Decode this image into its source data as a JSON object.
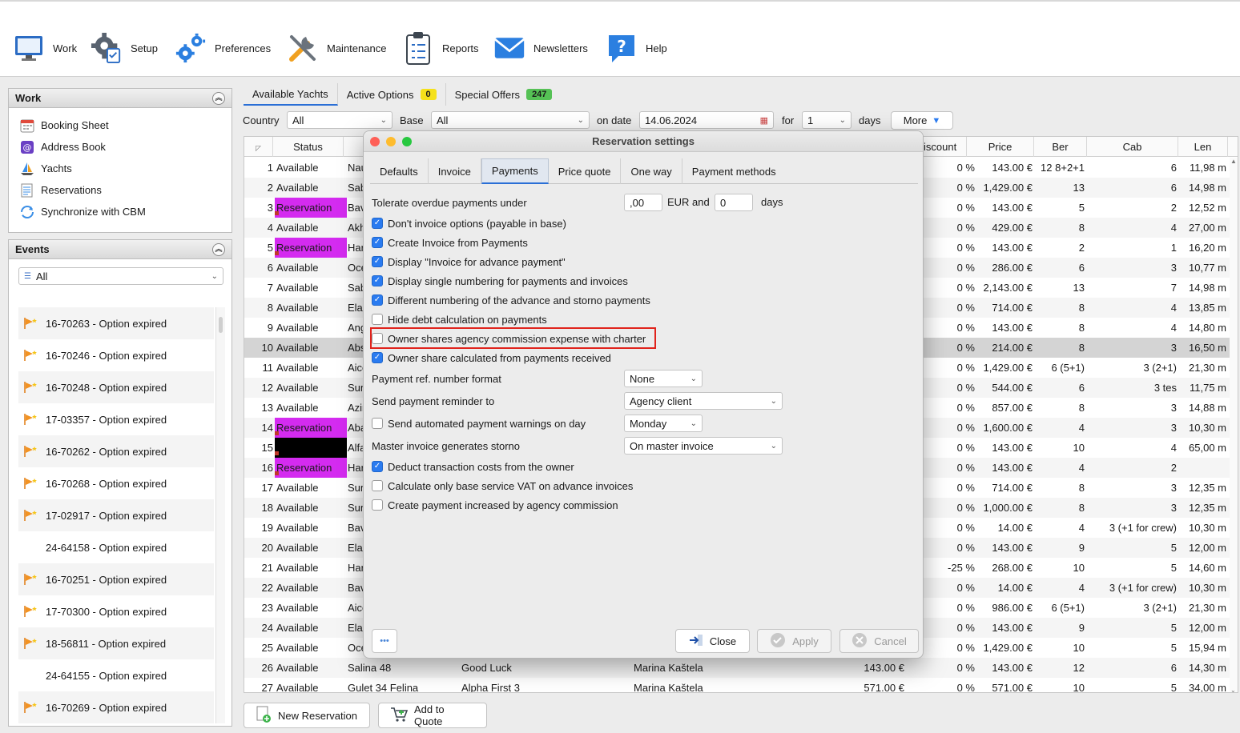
{
  "toolbar": [
    {
      "label": "Work",
      "icon": "monitor-icon"
    },
    {
      "label": "Setup",
      "icon": "gear-checklist-icon"
    },
    {
      "label": "Preferences",
      "icon": "gears-icon"
    },
    {
      "label": "Maintenance",
      "icon": "tools-icon"
    },
    {
      "label": "Reports",
      "icon": "clipboard-icon"
    },
    {
      "label": "Newsletters",
      "icon": "envelope-icon"
    },
    {
      "label": "Help",
      "icon": "help-icon"
    }
  ],
  "work_panel": {
    "title": "Work",
    "items": [
      "Booking Sheet",
      "Address Book",
      "Yachts",
      "Reservations",
      "Synchronize with CBM"
    ]
  },
  "events_panel": {
    "title": "Events",
    "filter": "All",
    "items": [
      {
        "text": "16-70263 - Option expired",
        "flag": true
      },
      {
        "text": "16-70246 - Option expired",
        "flag": true
      },
      {
        "text": "16-70248 - Option expired",
        "flag": true
      },
      {
        "text": "17-03357 - Option expired",
        "flag": true
      },
      {
        "text": "16-70262 - Option expired",
        "flag": true
      },
      {
        "text": "16-70268 - Option expired",
        "flag": true
      },
      {
        "text": "17-02917 - Option expired",
        "flag": true
      },
      {
        "text": "24-64158 - Option expired",
        "flag": false
      },
      {
        "text": "16-70251 - Option expired",
        "flag": true
      },
      {
        "text": "17-70300 - Option expired",
        "flag": true
      },
      {
        "text": "18-56811 - Option expired",
        "flag": true
      },
      {
        "text": "24-64155 - Option expired",
        "flag": false
      },
      {
        "text": "16-70269 - Option expired",
        "flag": true
      }
    ]
  },
  "main_tabs": [
    {
      "label": "Available Yachts",
      "badge": "",
      "badge_color": ""
    },
    {
      "label": "Active Options",
      "badge": "0",
      "badge_color": "#f5e11a"
    },
    {
      "label": "Special Offers",
      "badge": "247",
      "badge_color": "#55c155"
    }
  ],
  "filters": {
    "country_label": "Country",
    "country_value": "All",
    "base_label": "Base",
    "base_value": "All",
    "on_date_label": "on date",
    "date_value": "14.06.2024",
    "for_label": "for",
    "days_value": "1",
    "days_label": "days",
    "more_label": "More"
  },
  "table": {
    "headers": {
      "status": "Status",
      "discount": "iscount",
      "price": "Price",
      "ber": "Ber",
      "cab": "Cab",
      "len": "Len"
    },
    "rows": [
      {
        "n": "1",
        "status": "Available",
        "name": "Nau",
        "disc": "0 %",
        "price": "143.00 €",
        "ber": "12 8+2+1",
        "cab": "6",
        "len": "11,98 m"
      },
      {
        "n": "2",
        "status": "Available",
        "name": "Sab",
        "disc": "0 %",
        "price": "1,429.00 €",
        "ber": "13",
        "cab": "6",
        "len": "14,98 m"
      },
      {
        "n": "3",
        "status": "Reservation",
        "name": "Bav",
        "disc": "0 %",
        "price": "143.00 €",
        "ber": "5",
        "cab": "2",
        "len": "12,52 m"
      },
      {
        "n": "4",
        "status": "Available",
        "name": "Akh",
        "disc": "0 %",
        "price": "429.00 €",
        "ber": "8",
        "cab": "4",
        "len": "27,00 m"
      },
      {
        "n": "5",
        "status": "Reservation",
        "name": "Har",
        "disc": "0 %",
        "price": "143.00 €",
        "ber": "2",
        "cab": "1",
        "len": "16,20 m"
      },
      {
        "n": "6",
        "status": "Available",
        "name": "Oce",
        "disc": "0 %",
        "price": "286.00 €",
        "ber": "6",
        "cab": "3",
        "len": "10,77 m"
      },
      {
        "n": "7",
        "status": "Available",
        "name": "Sab",
        "disc": "0 %",
        "price": "2,143.00 €",
        "ber": "13",
        "cab": "7",
        "len": "14,98 m"
      },
      {
        "n": "8",
        "status": "Available",
        "name": "Elan",
        "disc": "0 %",
        "price": "714.00 €",
        "ber": "8",
        "cab": "4",
        "len": "13,85 m"
      },
      {
        "n": "9",
        "status": "Available",
        "name": "Ang",
        "disc": "0 %",
        "price": "143.00 €",
        "ber": "8",
        "cab": "4",
        "len": "14,80 m"
      },
      {
        "n": "10",
        "status": "Available",
        "name": "Abs",
        "disc": "0 %",
        "price": "214.00 €",
        "ber": "8",
        "cab": "3",
        "len": "16,50 m"
      },
      {
        "n": "11",
        "status": "Available",
        "name": "Aico",
        "disc": "0 %",
        "price": "1,429.00 €",
        "ber": "6 (5+1)",
        "cab": "3 (2+1)",
        "len": "21,30 m"
      },
      {
        "n": "12",
        "status": "Available",
        "name": "Sun",
        "disc": "0 %",
        "price": "544.00 €",
        "ber": "6",
        "cab": "3 tes",
        "len": "11,75 m"
      },
      {
        "n": "13",
        "status": "Available",
        "name": "Azin",
        "disc": "0 %",
        "price": "857.00 €",
        "ber": "8",
        "cab": "3",
        "len": "14,88 m"
      },
      {
        "n": "14",
        "status": "Reservation",
        "name": "Aba",
        "disc": "0 %",
        "price": "1,600.00 €",
        "ber": "4",
        "cab": "3",
        "len": "10,30 m"
      },
      {
        "n": "15",
        "status": "",
        "name": "Alfa",
        "disc": "0 %",
        "price": "143.00 €",
        "ber": "10",
        "cab": "4",
        "len": "65,00 m"
      },
      {
        "n": "16",
        "status": "Reservation",
        "name": "Har",
        "disc": "0 %",
        "price": "143.00 €",
        "ber": "4",
        "cab": "2",
        "len": ""
      },
      {
        "n": "17",
        "status": "Available",
        "name": "Sun",
        "disc": "0 %",
        "price": "714.00 €",
        "ber": "8",
        "cab": "3",
        "len": "12,35 m"
      },
      {
        "n": "18",
        "status": "Available",
        "name": "Sun",
        "disc": "0 %",
        "price": "1,000.00 €",
        "ber": "8",
        "cab": "3",
        "len": "12,35 m"
      },
      {
        "n": "19",
        "status": "Available",
        "name": "Bav",
        "disc": "0 %",
        "price": "14.00 €",
        "ber": "4",
        "cab": "3 (+1 for crew)",
        "len": "10,30 m"
      },
      {
        "n": "20",
        "status": "Available",
        "name": "Elan",
        "disc": "0 %",
        "price": "143.00 €",
        "ber": "9",
        "cab": "5",
        "len": "12,00 m"
      },
      {
        "n": "21",
        "status": "Available",
        "name": "Har",
        "disc": "-25 %",
        "price": "268.00 €",
        "ber": "10",
        "cab": "5",
        "len": "14,60 m"
      },
      {
        "n": "22",
        "status": "Available",
        "name": "Bav",
        "disc": "0 %",
        "price": "14.00 €",
        "ber": "4",
        "cab": "3 (+1 for crew)",
        "len": "10,30 m"
      },
      {
        "n": "23",
        "status": "Available",
        "name": "Aico",
        "disc": "0 %",
        "price": "986.00 €",
        "ber": "6 (5+1)",
        "cab": "3 (2+1)",
        "len": "21,30 m"
      },
      {
        "n": "24",
        "status": "Available",
        "name": "Elan",
        "disc": "0 %",
        "price": "143.00 €",
        "ber": "9",
        "cab": "5",
        "len": "12,00 m"
      },
      {
        "n": "25",
        "status": "Available",
        "name": "Oce",
        "disc": "0 %",
        "price": "1,429.00 €",
        "ber": "10",
        "cab": "5",
        "len": "15,94 m"
      },
      {
        "n": "26",
        "status": "Available",
        "name": "Salina 48",
        "model": "Good Luck",
        "base": "Marina Kaštela",
        "baseprice": "143.00 €",
        "disc": "0 %",
        "price": "143.00 €",
        "ber": "12",
        "cab": "6",
        "len": "14,30 m"
      },
      {
        "n": "27",
        "status": "Available",
        "name": "Gulet 34 Felina",
        "model": "Alpha First 3",
        "base": "Marina Kaštela",
        "baseprice": "571.00 €",
        "disc": "0 %",
        "price": "571.00 €",
        "ber": "10",
        "cab": "5",
        "len": "34,00 m"
      }
    ]
  },
  "bottom_buttons": {
    "new_reservation": "New Reservation",
    "add_to_quote": "Add to Quote"
  },
  "dialog": {
    "title": "Reservation settings",
    "tabs": [
      "Defaults",
      "Invoice",
      "Payments",
      "Price quote",
      "One way",
      "Payment methods"
    ],
    "active_tab": "Payments",
    "tolerate_label": "Tolerate overdue payments under",
    "tolerate_amount": ",00",
    "eur_and": "EUR and",
    "tolerate_days": "0",
    "days": "days",
    "checkboxes": [
      {
        "label": "Don't invoice options (payable in base)",
        "checked": true
      },
      {
        "label": "Create Invoice from Payments",
        "checked": true
      },
      {
        "label": "Display \"Invoice for advance payment\"",
        "checked": true
      },
      {
        "label": "Display single numbering for payments and invoices",
        "checked": true
      },
      {
        "label": "Different numbering of the advance and storno payments",
        "checked": true
      },
      {
        "label": "Hide debt calculation on payments",
        "checked": false
      },
      {
        "label": "Owner shares agency commission expense with charter",
        "checked": false
      },
      {
        "label": "Owner share calculated from payments received",
        "checked": true
      }
    ],
    "payment_ref_label": "Payment ref. number format",
    "payment_ref_value": "None",
    "reminder_label": "Send payment reminder to",
    "reminder_value": "Agency client",
    "auto_warn_label": "Send automated payment warnings on day",
    "auto_warn_checked": false,
    "auto_warn_value": "Monday",
    "master_label": "Master invoice generates storno",
    "master_value": "On master invoice",
    "checkboxes2": [
      {
        "label": "Deduct transaction costs from the owner",
        "checked": true
      },
      {
        "label": "Calculate only base service VAT on advance invoices",
        "checked": false
      },
      {
        "label": "Create payment increased by agency commission",
        "checked": false
      }
    ],
    "buttons": {
      "more": "•••",
      "close": "Close",
      "apply": "Apply",
      "cancel": "Cancel"
    }
  }
}
